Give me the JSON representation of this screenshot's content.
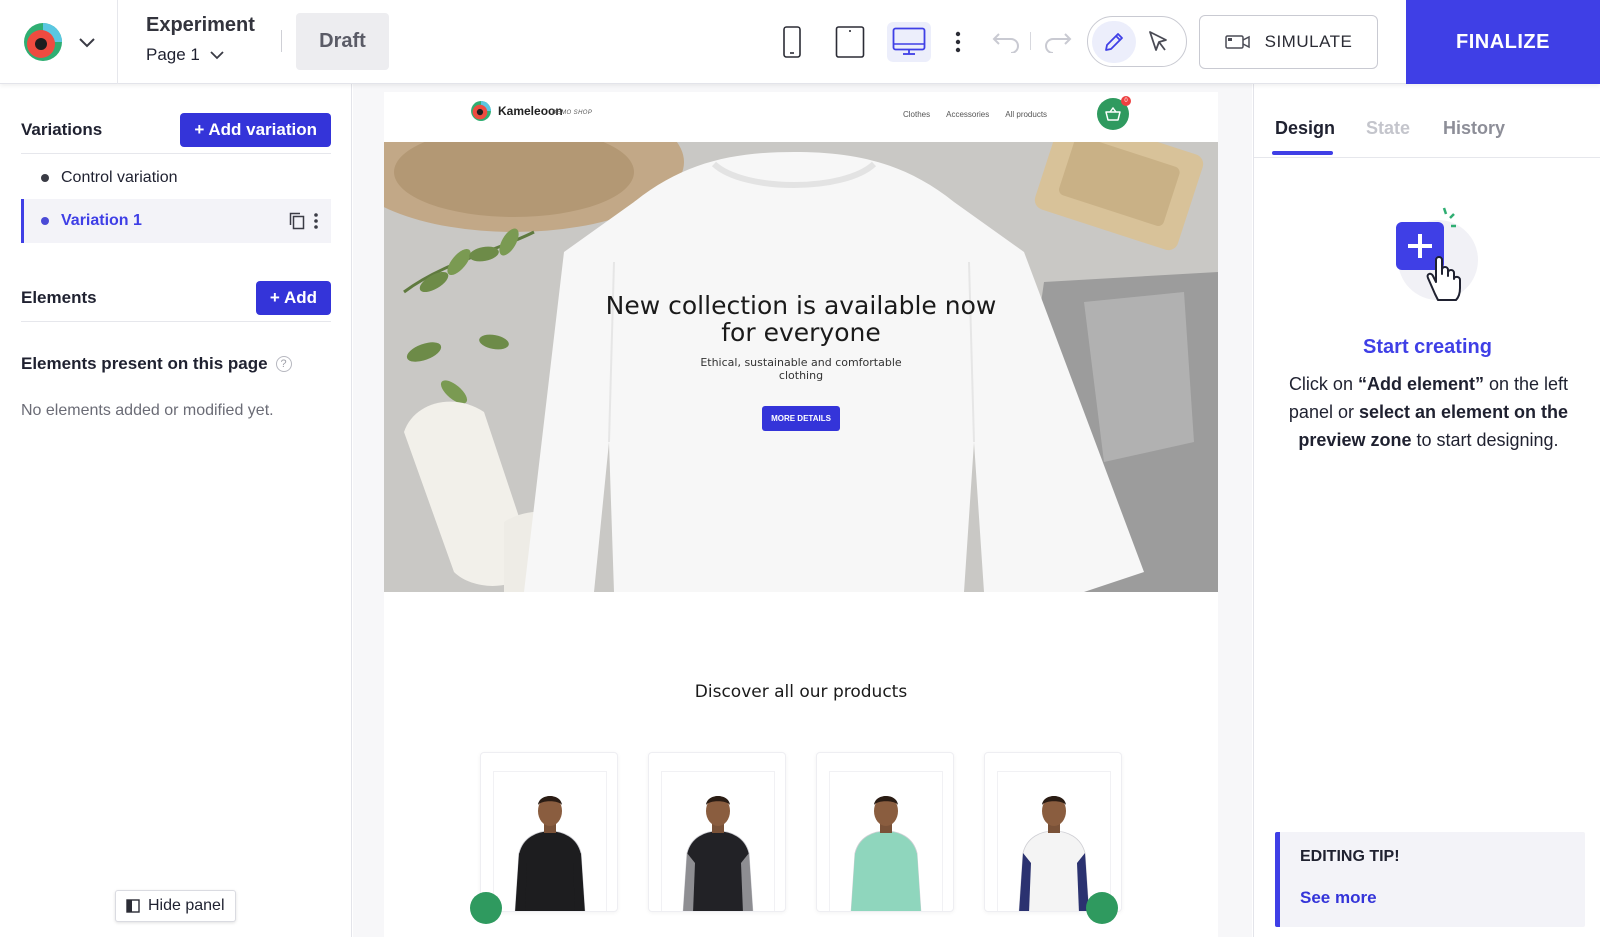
{
  "header": {
    "experiment_title": "Experiment",
    "page_selector": "Page 1",
    "status_badge": "Draft",
    "simulate_label": "SIMULATE",
    "finalize_label": "FINALIZE",
    "icons": {
      "logo": "kameleoon-logo-icon",
      "logo_menu": "chevron-down-icon",
      "page_menu": "chevron-down-icon",
      "devices": [
        "mobile-icon",
        "tablet-icon",
        "desktop-icon"
      ],
      "more": "more-vertical-icon",
      "undo": "undo-icon",
      "redo": "redo-icon",
      "modes": [
        "pencil-icon",
        "cursor-icon"
      ],
      "simulate": "camera-icon"
    },
    "active_device": "desktop",
    "active_mode": "edit"
  },
  "left_panel": {
    "variations_title": "Variations",
    "add_variation_label": "+ Add variation",
    "variations": [
      {
        "label": "Control variation",
        "selected": false
      },
      {
        "label": "Variation 1",
        "selected": true
      }
    ],
    "elements_title": "Elements",
    "add_element_label": "+ Add",
    "elements_present_title": "Elements present on this page",
    "help_glyph": "?",
    "empty_note": "No elements added or modified yet.",
    "hide_panel_label": "Hide panel"
  },
  "preview": {
    "brand_name": "Kameleoon",
    "brand_sub": "DEMO SHOP",
    "nav_links": [
      "Clothes",
      "Accessories",
      "All products"
    ],
    "cart_count": "0",
    "hero_title": "New collection is available now for everyone",
    "hero_subtitle": "Ethical, sustainable and comfortable clothing",
    "hero_cta": "MORE DETAILS",
    "section_title": "Discover all our products",
    "products": [
      {
        "name": "black-hoodie",
        "shirt_color": "#1d1d1f",
        "accent": "#1d1d1f"
      },
      {
        "name": "zip-hoodie",
        "shirt_color": "#222226",
        "accent": "#8e8e92"
      },
      {
        "name": "mint-sweater",
        "shirt_color": "#8fd6bd",
        "accent": "#8fd6bd"
      },
      {
        "name": "raglan-tee",
        "shirt_color": "#f4f4f4",
        "accent": "#2b3270"
      }
    ]
  },
  "right_panel": {
    "tabs": [
      {
        "label": "Design",
        "state": "active"
      },
      {
        "label": "State",
        "state": "disabled"
      },
      {
        "label": "History",
        "state": "inactive"
      }
    ],
    "start_title": "Start creating",
    "start_desc_parts": {
      "p1": "Click on ",
      "b1": "“Add element”",
      "p2": " on the left panel or ",
      "b2": "select an element on the preview zone",
      "p3": " to start designing."
    },
    "tip_title": "EDITING TIP!",
    "tip_link": "See more"
  },
  "colors": {
    "accent": "#3f3fe6",
    "primary_button": "#3434d9",
    "shop_green": "#2f9a5f",
    "badge_red": "#ee4040"
  }
}
